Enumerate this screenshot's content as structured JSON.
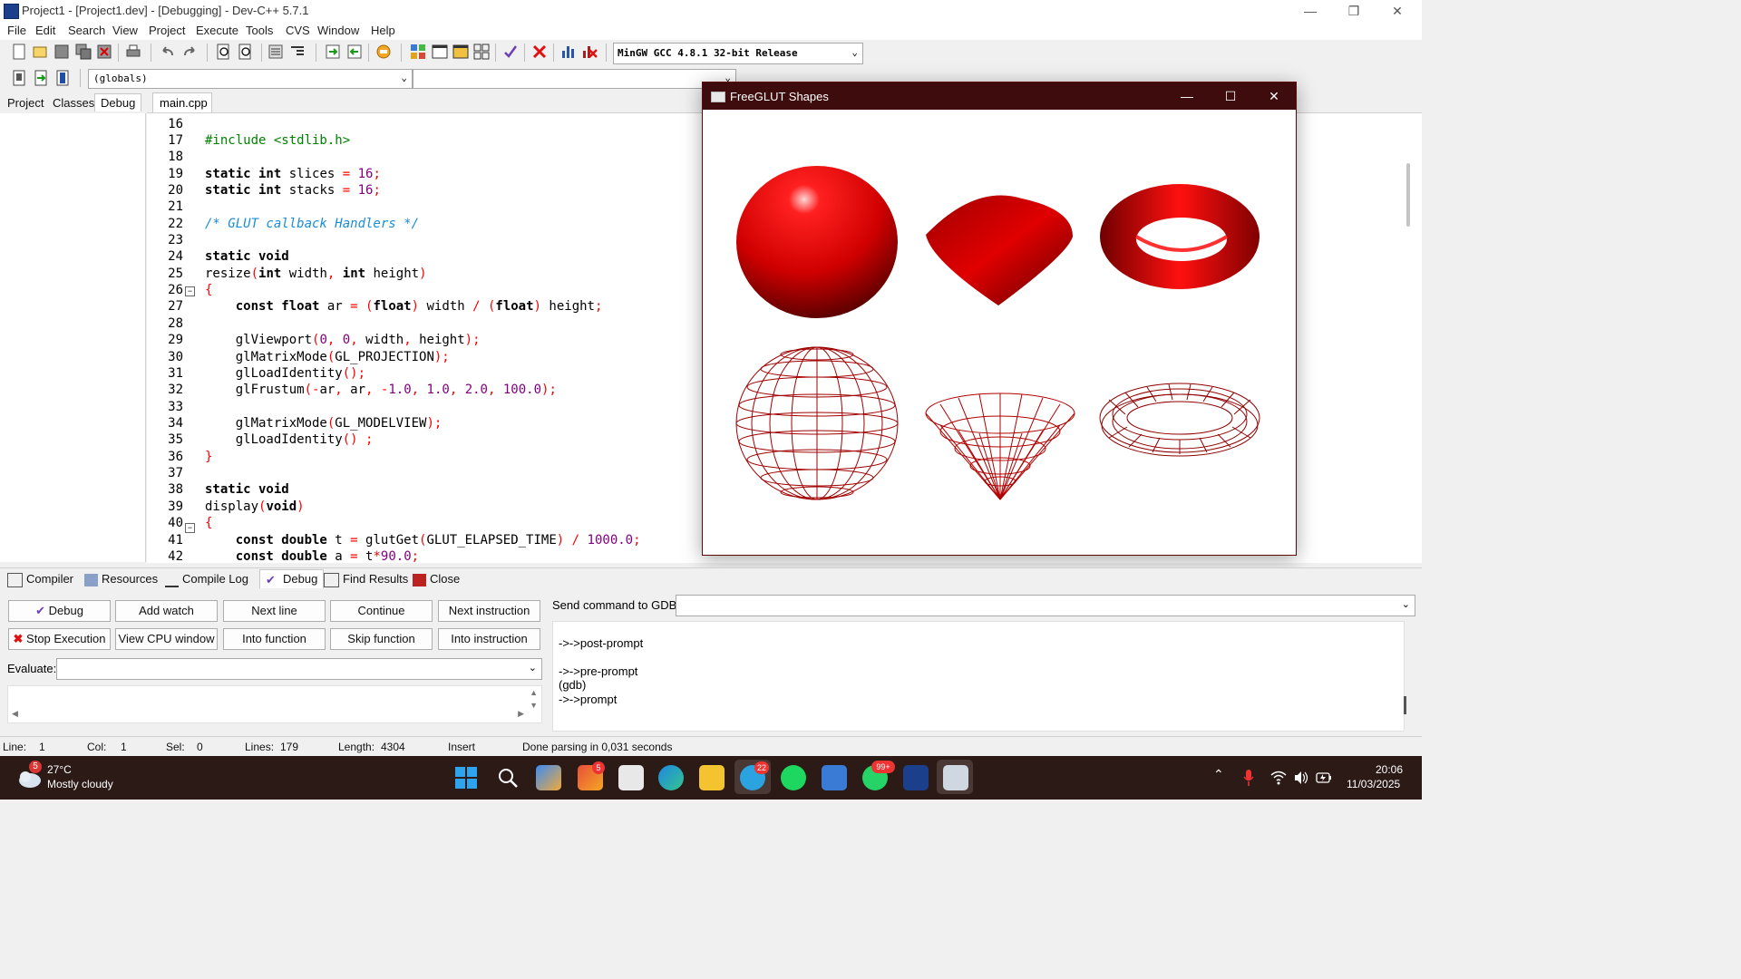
{
  "titlebar": {
    "title": "Project1 - [Project1.dev] - [Debugging] - Dev-C++ 5.7.1",
    "min": "—",
    "restore": "❐",
    "close": "✕"
  },
  "menu": [
    "File",
    "Edit",
    "Search",
    "View",
    "Project",
    "Execute",
    "Tools",
    "CVS",
    "Window",
    "Help"
  ],
  "toolbar": {
    "compiler_select": "MinGW GCC 4.8.1 32-bit Release",
    "globals_select": "(globals)"
  },
  "left_tabs": [
    "Project",
    "Classes",
    "Debug"
  ],
  "editor": {
    "tab": "main.cpp",
    "lines": [
      16,
      17,
      18,
      19,
      20,
      21,
      22,
      23,
      24,
      25,
      26,
      27,
      28,
      29,
      30,
      31,
      32,
      33,
      34,
      35,
      36,
      37,
      38,
      39,
      40,
      41,
      42
    ]
  },
  "glut": {
    "title": "FreeGLUT Shapes",
    "min": "—",
    "max": "☐",
    "close": "✕",
    "accent": "#e00000"
  },
  "bottom_tabs": [
    "Compiler",
    "Resources",
    "Compile Log",
    "Debug",
    "Find Results",
    "Close"
  ],
  "debug": {
    "buttons_row1": [
      "Debug",
      "Add watch",
      "Next line",
      "Continue",
      "Next instruction"
    ],
    "buttons_row2": [
      "Stop Execution",
      "View CPU window",
      "Into function",
      "Skip function",
      "Into instruction"
    ],
    "evaluate_label": "Evaluate:",
    "gdb_label": "Send command to GDB:",
    "gdb_output": [
      "->->post-prompt",
      "",
      "->->pre-prompt",
      "(gdb)",
      "->->prompt"
    ]
  },
  "status": {
    "line_label": "Line:",
    "line": "1",
    "col_label": "Col:",
    "col": "1",
    "sel_label": "Sel:",
    "sel": "0",
    "lines_label": "Lines:",
    "lines": "179",
    "length_label": "Length:",
    "length": "4304",
    "mode": "Insert",
    "message": "Done parsing in 0,031 seconds"
  },
  "taskbar": {
    "weather_temp": "27°C",
    "weather_desc": "Mostly cloudy",
    "weather_badge": "5",
    "time": "20:06",
    "date": "11/03/2025",
    "badge_photos": "5",
    "badge_telegram": "22",
    "badge_whatsapp": "99+"
  }
}
